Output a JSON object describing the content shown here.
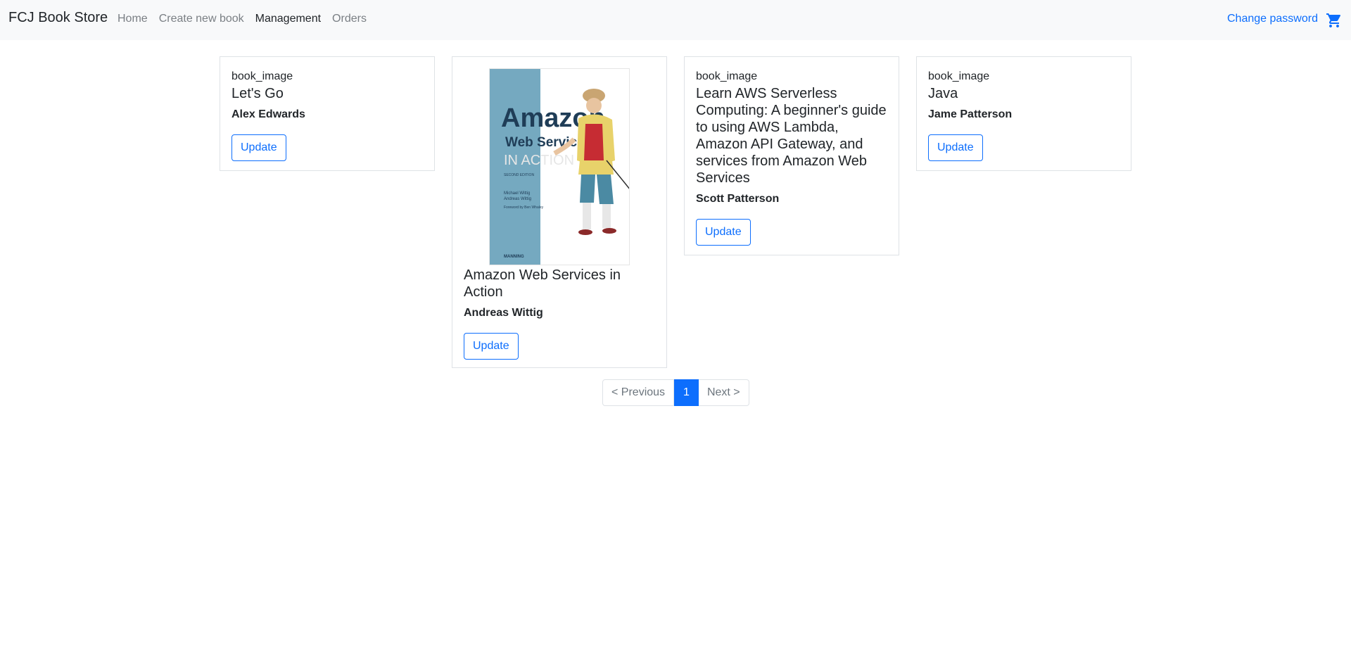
{
  "navbar": {
    "brand": "FCJ Book Store",
    "links": [
      "Home",
      "Create new book",
      "Management",
      "Orders"
    ],
    "active": "Management",
    "change_password": "Change password",
    "cart_icon": "cart-icon"
  },
  "books": [
    {
      "image_alt": "book_image",
      "title": "Let's Go",
      "author": "Alex Edwards",
      "button": "Update"
    },
    {
      "image_alt": "book_image",
      "title": "Amazon Web Services in Action",
      "author": "Andreas Wittig",
      "button": "Update",
      "cover": {
        "line1": "Amazon",
        "line2": "Web Services",
        "line3": "IN ACTION",
        "edition": "SECOND EDITION",
        "authors": [
          "Michael Wittig",
          "Andreas Wittig"
        ],
        "foreword": "Foreword by Ben Whaley",
        "publisher": "MANNING"
      }
    },
    {
      "image_alt": "book_image",
      "title": "Learn AWS Serverless Computing: A beginner's guide to using AWS Lambda, Amazon API Gateway, and services from Amazon Web Services",
      "author": "Scott Patterson",
      "button": "Update"
    },
    {
      "image_alt": "book_image",
      "title": "Java",
      "author": "Jame Patterson",
      "button": "Update"
    }
  ],
  "pagination": {
    "previous": "< Previous",
    "current": "1",
    "next": "Next >"
  },
  "colors": {
    "accent": "#0d6efd",
    "cover_teal": "#75a9c0"
  }
}
